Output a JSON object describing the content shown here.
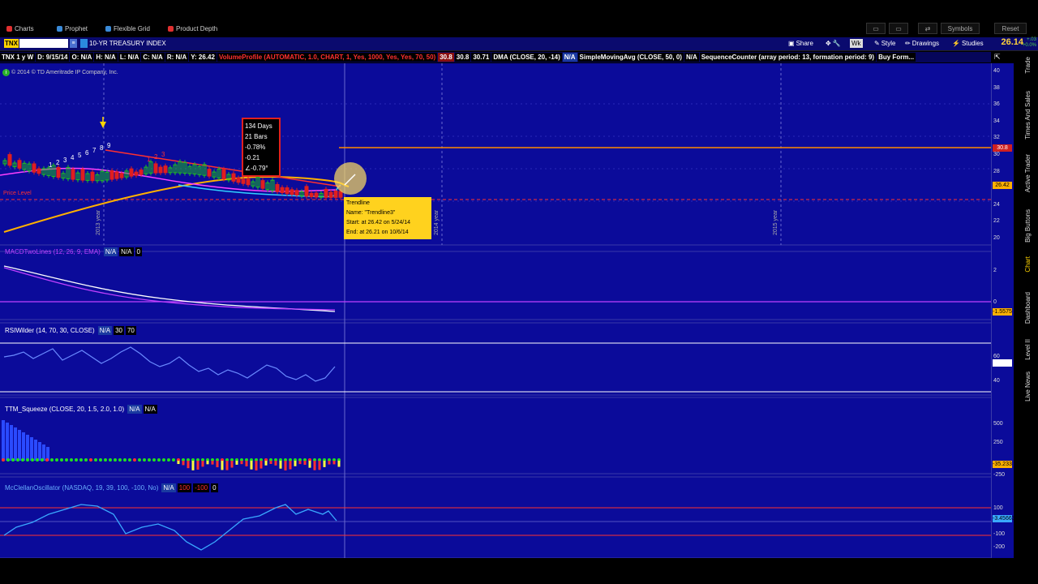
{
  "topbar": {
    "tabs": [
      {
        "label": "Charts",
        "color": "#e03030"
      },
      {
        "label": "Prophet",
        "color": "#3a8ad8"
      },
      {
        "label": "Flexible Grid",
        "color": "#3a8ad8"
      },
      {
        "label": "Product Depth",
        "color": "#e03030"
      }
    ],
    "symbols_label": "Symbols",
    "reset_label": "Reset"
  },
  "header": {
    "symbol": "TNX",
    "description": "10-YR TREASURY INDEX",
    "share": "Share",
    "wk": "Wk",
    "style": "Style",
    "drawings": "Drawings",
    "studies": "Studies",
    "price": "26.14",
    "change_1": "+.03",
    "change_2": "+0.0%"
  },
  "studyline": [
    {
      "text": "TNX 1 y W",
      "color": "#ffffff",
      "bg": "#000"
    },
    {
      "text": "D: 9/15/14",
      "color": "#ffffff",
      "bg": "#000"
    },
    {
      "text": "O: N/A",
      "color": "#ffffff",
      "bg": "#000"
    },
    {
      "text": "H: N/A",
      "color": "#ffffff",
      "bg": "#000"
    },
    {
      "text": "L: N/A",
      "color": "#ffffff",
      "bg": "#000"
    },
    {
      "text": "C: N/A",
      "color": "#ffffff",
      "bg": "#000"
    },
    {
      "text": "R: N/A",
      "color": "#ffffff",
      "bg": "#000"
    },
    {
      "text": "Y: 26.42",
      "color": "#ffffff",
      "bg": "#000"
    },
    {
      "text": "VolumeProfile (AUTOMATIC, 1.0, CHART, 1, Yes, 1000, Yes, Yes, 70, 50)",
      "color": "#ff3030",
      "bg": "#000"
    },
    {
      "text": "30.8",
      "color": "#ffffff",
      "bg": "#8a1010"
    },
    {
      "text": "30.8",
      "color": "#ffffff",
      "bg": "#000"
    },
    {
      "text": "30.71",
      "color": "#ffffff",
      "bg": "#000"
    },
    {
      "text": "DMA (CLOSE, 20, -14)",
      "color": "#ffffff",
      "bg": "#000"
    },
    {
      "text": "N/A",
      "color": "#ffffff",
      "bg": "#1a3aa0"
    },
    {
      "text": "SimpleMovingAvg (CLOSE, 50, 0)",
      "color": "#ffffff",
      "bg": "#000"
    },
    {
      "text": "N/A",
      "color": "#ffffff",
      "bg": "#000"
    },
    {
      "text": "SequenceCounter (array period: 13, formation period: 9)",
      "color": "#ffffff",
      "bg": "#000"
    },
    {
      "text": "Buy Form...",
      "color": "#ffffff",
      "bg": "#000"
    }
  ],
  "chart": {
    "copyright": "© 2014 © TD Ameritrade IP Company, Inc.",
    "year_labels": [
      "2013 year",
      "2014 year",
      "2015 year"
    ],
    "price_level_label": "Price Level",
    "y_labels": [
      "40",
      "38",
      "36",
      "34",
      "32",
      "30",
      "28",
      "26",
      "24",
      "22",
      "20"
    ],
    "markers": {
      "vp": "30.8",
      "price": "26.42"
    },
    "tooltip1": [
      "134 Days",
      "21 Bars",
      "-0.78%",
      "-0.21",
      "∠-0.79°"
    ],
    "tooltip2": [
      "Trendline",
      "Name: \"Trendline3\"",
      "Start: at 26.42 on 5/24/14",
      "End: at 26.21 on 10/6/14"
    ],
    "seq_counts": [
      "1",
      "2",
      "3",
      "4",
      "5",
      "6",
      "7",
      "8",
      "9",
      "1",
      "2",
      "3"
    ]
  },
  "panels": {
    "macd": {
      "title": "MACDTwoLines (12, 26, 9, EMA)",
      "v1": "N/A",
      "v2": "N/A",
      "v3": "0",
      "y_labels": [
        "2",
        "0"
      ],
      "marker": "-1.5575"
    },
    "rsi": {
      "title": "RSIWilder (14, 70, 30, CLOSE)",
      "v1": "N/A",
      "v2": "30",
      "v3": "70",
      "y_labels": [
        "60",
        "40"
      ],
      "marker": ""
    },
    "ttm": {
      "title": "TTM_Squeeze (CLOSE, 20, 1.5, 2.0, 1.0)",
      "v1": "N/A",
      "v2": "N/A",
      "y_labels": [
        "500",
        "250",
        "-250"
      ],
      "marker": "-35.233"
    },
    "mco": {
      "title": "McClellanOscillator (NASDAQ, 19, 39, 100, -100, No)",
      "v1": "N/A",
      "v2": "100",
      "v3": "-100",
      "v4": "0",
      "y_labels": [
        "100",
        "-100",
        "-200"
      ],
      "marker": "-3.45663"
    }
  },
  "side_tabs": [
    "Trade",
    "Times And Sales",
    "Active Trader",
    "Big Buttons",
    "Chart",
    "Dashboard",
    "Level II",
    "Live News"
  ],
  "colors": {
    "chart_bg": "#0b0b9a",
    "up": "#1ec01e",
    "down": "#e01e1e",
    "sma": "#ffb000",
    "macd_a": "#ffffff",
    "macd_b": "#c040ff",
    "rsi": "#6a8aff",
    "mco": "#3aa8ff"
  }
}
